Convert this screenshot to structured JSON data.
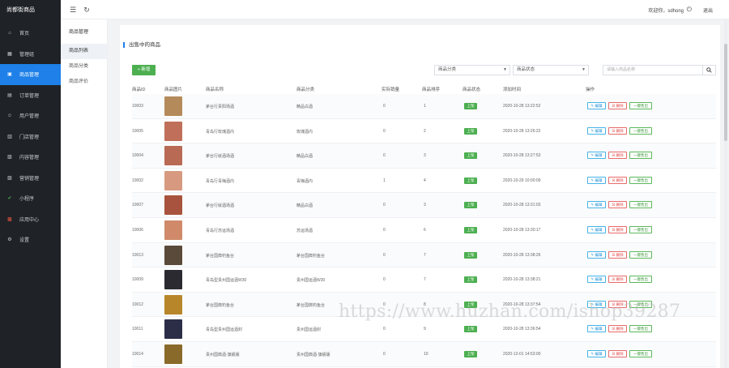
{
  "app": {
    "brand": "尚都街商品"
  },
  "sidebar": {
    "items": [
      {
        "label": "首页",
        "icon": "home-icon"
      },
      {
        "label": "管理组",
        "icon": "group-icon"
      },
      {
        "label": "商品管理",
        "icon": "product-icon",
        "active": true
      },
      {
        "label": "订单管理",
        "icon": "order-icon"
      },
      {
        "label": "用户管理",
        "icon": "user-icon"
      },
      {
        "label": "门店管理",
        "icon": "store-icon"
      },
      {
        "label": "内容管理",
        "icon": "content-icon"
      },
      {
        "label": "营销管理",
        "icon": "marketing-icon"
      },
      {
        "label": "小程序",
        "icon": "miniprogram-icon"
      },
      {
        "label": "应用中心",
        "icon": "apps-icon"
      },
      {
        "label": "设置",
        "icon": "gear-icon"
      }
    ]
  },
  "header": {
    "welcome": "欢迎你，sdhong",
    "logout": "退出"
  },
  "submenu": {
    "title": "商品管理",
    "items": [
      {
        "label": "商品列表",
        "active": true
      },
      {
        "label": "商品分类"
      },
      {
        "label": "商品评价"
      }
    ]
  },
  "main": {
    "title": "出售中的商品",
    "add_label": "+ 新增",
    "filters": {
      "category": "商品分类",
      "status": "商品状态",
      "search_placeholder": "请输入商品名称"
    },
    "columns": [
      "商品ID",
      "商品图片",
      "商品名称",
      "商品分类",
      "实际销量",
      "商品排序",
      "商品状态",
      "添加时间",
      "操作"
    ],
    "ops": {
      "edit": "✎ 编辑",
      "delete": "☒ 删除",
      "off": "一键售出"
    },
    "rows": [
      {
        "id": "10003",
        "name": "茅台行贵阳场酒",
        "category": "精品白酒",
        "sales": "0",
        "sort": "1",
        "status": "上架",
        "time": "2020-10-28 13:22:52",
        "color": "#b58a5a",
        "alt": true
      },
      {
        "id": "10005",
        "name": "青岛行玫瑰酒内",
        "category": "玫瑰酒内",
        "sales": "0",
        "sort": "2",
        "status": "上架",
        "time": "2020-10-28 13:26:22",
        "color": "#c0705a",
        "alt": false
      },
      {
        "id": "10004",
        "name": "茅台行就酒场酒",
        "category": "精品白酒",
        "sales": "0",
        "sort": "3",
        "status": "上架",
        "time": "2020-10-28 13:27:53",
        "color": "#b86a55",
        "alt": true
      },
      {
        "id": "10002",
        "name": "青岛行青梅酒内",
        "category": "青梅酒内",
        "sales": "1",
        "sort": "4",
        "status": "上架",
        "time": "2020-10-29 10:00:09",
        "color": "#d79a80",
        "alt": false
      },
      {
        "id": "10007",
        "name": "茅台行就酒场酒",
        "category": "精品白酒",
        "sales": "0",
        "sort": "3",
        "status": "上架",
        "time": "2020-10-28 13:31:03",
        "color": "#a8533d",
        "alt": true
      },
      {
        "id": "10006",
        "name": "青岛行苏运场酒",
        "category": "苏运场酒",
        "sales": "0",
        "sort": "6",
        "status": "上架",
        "time": "2020-10-28 13:30:17",
        "color": "#d08a6a",
        "alt": false
      },
      {
        "id": "10013",
        "name": "茅台国典钓鱼台",
        "category": "茅台国典钓鱼台",
        "sales": "0",
        "sort": "7",
        "status": "上架",
        "time": "2020-10-28 13:38:26",
        "color": "#5a4a3a",
        "alt": true
      },
      {
        "id": "10009",
        "name": "青岛型贵州国运酒W30",
        "category": "贵州国运酒W30",
        "sales": "0",
        "sort": "7",
        "status": "上架",
        "time": "2020-10-28 13:38:21",
        "color": "#2a2a30",
        "alt": false
      },
      {
        "id": "10012",
        "name": "茅台国典钓鱼台",
        "category": "茅台国典钓鱼台",
        "sales": "0",
        "sort": "8",
        "status": "上架",
        "time": "2020-10-28 13:37:54",
        "color": "#b8862a",
        "alt": true
      },
      {
        "id": "10011",
        "name": "青岛型贵州国运酒封",
        "category": "贵州国运酒封",
        "sales": "0",
        "sort": "9",
        "status": "上架",
        "time": "2020-10-28 13:36:54",
        "color": "#2c2e48",
        "alt": false
      },
      {
        "id": "10014",
        "name": "贵州国典酒·旗舰版",
        "category": "贵州国典酒·旗舰版",
        "sales": "0",
        "sort": "10",
        "status": "上架",
        "time": "2020-12-01 14:53:00",
        "color": "#8a6a2a",
        "alt": true
      }
    ]
  },
  "watermark": "https://www.huzhan.com/ishop39287"
}
